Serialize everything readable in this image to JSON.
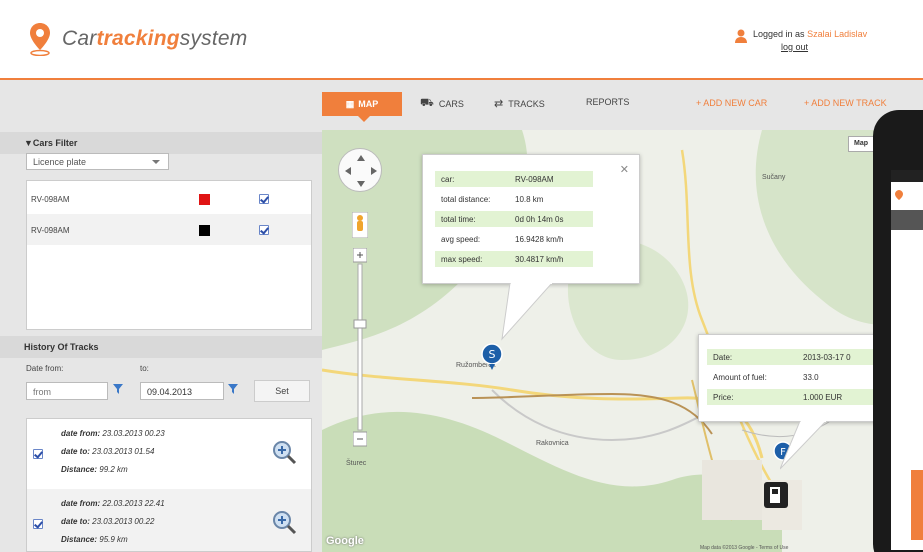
{
  "header": {
    "logo_prefix": "Car",
    "logo_accent": "tracking",
    "logo_suffix": "system",
    "logged_in_label": "Logged in as",
    "user_name": "Szalai Ladislav",
    "logout": "log out"
  },
  "nav": {
    "map": "MAP",
    "cars": "CARS",
    "tracks": "TRACKS",
    "reports": "REPORTS",
    "add_car": "+ ADD NEW CAR",
    "add_track": "+ ADD NEW TRACK"
  },
  "cars_filter": {
    "title": "▼Cars Filter",
    "select_value": "Licence plate",
    "cars": [
      {
        "plate": "RV-098AM",
        "color": "#e01414",
        "checked": true
      },
      {
        "plate": "RV-098AM",
        "color": "#000000",
        "checked": true
      }
    ]
  },
  "history": {
    "title": "History Of Tracks",
    "date_from_label": "Date from:",
    "date_to_label": "to:",
    "from_placeholder": "from",
    "to_value": "09.04.2013",
    "set_button": "Set",
    "tracks": [
      {
        "from_label": "date from:",
        "from": "23.03.2013 00.23",
        "to_label": "date to:",
        "to": "23.03.2013 01.54",
        "distance_label": "Distance:",
        "distance": "99.2 km"
      },
      {
        "from_label": "date from:",
        "from": "22.03.2013 22.41",
        "to_label": "date to:",
        "to": "23.03.2013 00.22",
        "distance_label": "Distance:",
        "distance": "95.9 km"
      }
    ]
  },
  "popup_track": {
    "rows": [
      {
        "k": "car:",
        "v": "RV-098AM",
        "hl": true
      },
      {
        "k": "total distance:",
        "v": "10.8 km",
        "hl": false
      },
      {
        "k": "total time:",
        "v": "0d 0h 14m 0s",
        "hl": true
      },
      {
        "k": "avg speed:",
        "v": "16.9428 km/h",
        "hl": false
      },
      {
        "k": "max speed:",
        "v": "30.4817 km/h",
        "hl": true
      }
    ]
  },
  "popup_fuel": {
    "rows": [
      {
        "k": "Date:",
        "v": "2013-03-17 0",
        "hl": true
      },
      {
        "k": "Amount of fuel:",
        "v": "33.0",
        "hl": false
      },
      {
        "k": "Price:",
        "v": "1.000 EUR",
        "hl": true
      }
    ]
  },
  "map": {
    "map_type_button": "Map",
    "google": "Google",
    "copyright": "Map data ©2013 Google - Terms of Use",
    "labels": [
      "Sučany",
      "Rakovnica",
      "Ružomberok",
      "Šturec"
    ]
  },
  "colors": {
    "accent": "#f07f3c",
    "hl": "#e2f3d3"
  }
}
